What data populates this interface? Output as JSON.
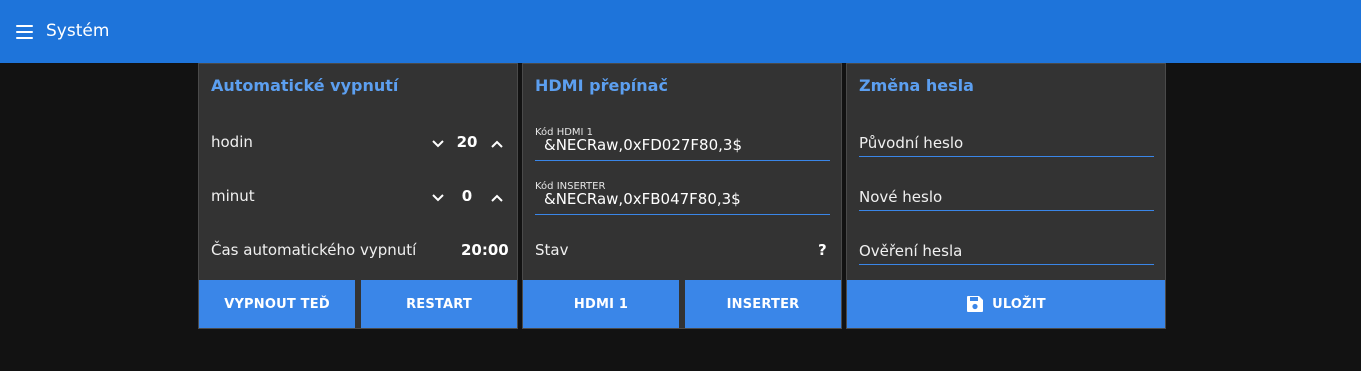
{
  "header": {
    "title": "Systém",
    "menu_icon": "hamburger-menu-icon",
    "background": "#1e74da"
  },
  "auto_off": {
    "title": "Automatické vypnutí",
    "hours_label": "hodin",
    "hours_value": "20",
    "minutes_label": "minut",
    "minutes_value": "0",
    "time_label": "Čas automatického vypnutí",
    "time_value": "20:00",
    "shutdown_button": "VYPNOUT TEĎ",
    "restart_button": "RESTART"
  },
  "hdmi": {
    "title": "HDMI přepínač",
    "code1_label": "Kód HDMI 1",
    "code1_value": "&NECRaw,0xFD027F80,3$",
    "code2_label": "Kód INSERTER",
    "code2_value": "&NECRaw,0xFB047F80,3$",
    "status_label": "Stav",
    "status_value": "?",
    "hdmi1_button": "HDMI 1",
    "inserter_button": "INSERTER"
  },
  "password": {
    "title": "Změna hesla",
    "old_placeholder": "Původní heslo",
    "new_placeholder": "Nové heslo",
    "confirm_placeholder": "Ověření hesla",
    "save_button": "ULOŽIT",
    "save_icon": "floppy-disk-icon"
  },
  "colors": {
    "accent": "#3a86e8",
    "card_title": "#5c9ff0",
    "card_bg": "#333333",
    "page_bg": "#121212"
  }
}
